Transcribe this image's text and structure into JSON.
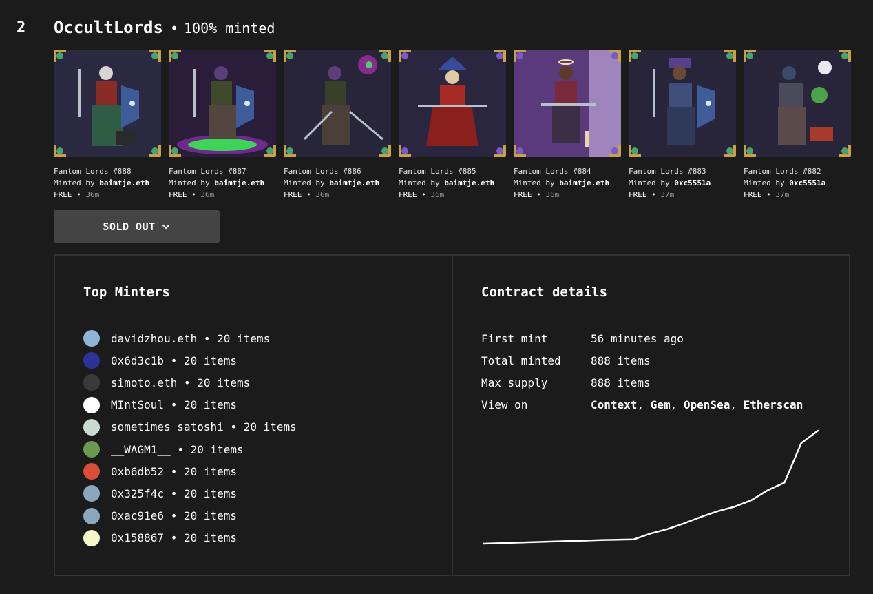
{
  "collection": {
    "rank": "2",
    "name": "OccultLords",
    "separator": "•",
    "minted_pct": "100% minted"
  },
  "items": [
    {
      "name": "Fantom Lords #888",
      "minted_by_prefix": "Minted by",
      "minter": "baimtje.eth",
      "price": "FREE",
      "sep": "•",
      "time": "36m"
    },
    {
      "name": "Fantom Lords #887",
      "minted_by_prefix": "Minted by",
      "minter": "baimtje.eth",
      "price": "FREE",
      "sep": "•",
      "time": "36m"
    },
    {
      "name": "Fantom Lords #886",
      "minted_by_prefix": "Minted by",
      "minter": "baimtje.eth",
      "price": "FREE",
      "sep": "•",
      "time": "36m"
    },
    {
      "name": "Fantom Lords #885",
      "minted_by_prefix": "Minted by",
      "minter": "baimtje.eth",
      "price": "FREE",
      "sep": "•",
      "time": "36m"
    },
    {
      "name": "Fantom Lords #884",
      "minted_by_prefix": "Minted by",
      "minter": "baimtje.eth",
      "price": "FREE",
      "sep": "•",
      "time": "36m"
    },
    {
      "name": "Fantom Lords #883",
      "minted_by_prefix": "Minted by",
      "minter": "0xc5551a",
      "price": "FREE",
      "sep": "•",
      "time": "37m"
    },
    {
      "name": "Fantom Lords #882",
      "minted_by_prefix": "Minted by",
      "minter": "0xc5551a",
      "price": "FREE",
      "sep": "•",
      "time": "37m"
    }
  ],
  "sold_out_button": {
    "label": "SOLD OUT",
    "icon": "chevron-down-icon"
  },
  "top_minters": {
    "title": "Top Minters",
    "rows": [
      {
        "name": "davidzhou.eth",
        "sep": "•",
        "count": "20 items",
        "avatar_color": "#8fb4d9"
      },
      {
        "name": "0x6d3c1b",
        "sep": "•",
        "count": "20 items",
        "avatar_color": "#2c3397"
      },
      {
        "name": "simoto.eth",
        "sep": "•",
        "count": "20 items",
        "avatar_color": "#3a3a3a"
      },
      {
        "name": "MIntSoul",
        "sep": "•",
        "count": "20 items",
        "avatar_color": "#ffffff"
      },
      {
        "name": "sometimes_satoshi",
        "sep": "•",
        "count": "20 items",
        "avatar_color": "#c9dad0"
      },
      {
        "name": "__WAGM1__",
        "sep": "•",
        "count": "20 items",
        "avatar_color": "#6a9a52"
      },
      {
        "name": "0xb6db52",
        "sep": "•",
        "count": "20 items",
        "avatar_color": "#dc4d38"
      },
      {
        "name": "0x325f4c",
        "sep": "•",
        "count": "20 items",
        "avatar_color": "#8aa7bd"
      },
      {
        "name": "0xac91e6",
        "sep": "•",
        "count": "20 items",
        "avatar_color": "#8aa7bd"
      },
      {
        "name": "0x158867",
        "sep": "•",
        "count": "20 items",
        "avatar_color": "#f5f7c9"
      }
    ]
  },
  "contract": {
    "title": "Contract details",
    "first_mint_label": "First mint",
    "first_mint_value": "56 minutes ago",
    "total_minted_label": "Total minted",
    "total_minted_value": "888 items",
    "max_supply_label": "Max supply",
    "max_supply_value": "888 items",
    "view_on_label": "View on",
    "links": [
      "Context",
      "Gem",
      "OpenSea",
      "Etherscan"
    ],
    "link_sep": ","
  },
  "chart_data": {
    "type": "line",
    "title": "",
    "xlabel": "",
    "ylabel": "",
    "grid": false,
    "x": [
      0,
      5,
      10,
      15,
      20,
      25,
      30,
      35,
      40,
      45,
      50,
      55,
      60,
      65,
      70,
      75,
      80,
      85,
      90,
      95,
      100
    ],
    "y": [
      0,
      4,
      8,
      12,
      16,
      20,
      24,
      28,
      31,
      34,
      80,
      115,
      160,
      210,
      255,
      290,
      340,
      420,
      480,
      790,
      888
    ],
    "ylim": [
      0,
      888
    ]
  }
}
